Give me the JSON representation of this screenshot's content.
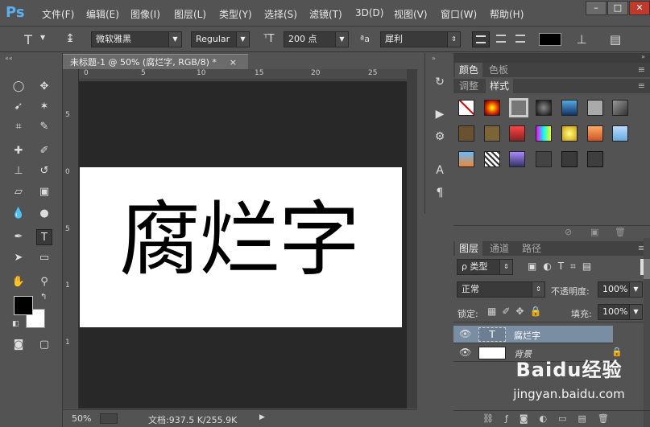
{
  "app": {
    "logo": "Ps"
  },
  "menu": [
    "文件(F)",
    "编辑(E)",
    "图像(I)",
    "图层(L)",
    "类型(Y)",
    "选择(S)",
    "滤镜(T)",
    "3D(D)",
    "视图(V)",
    "窗口(W)",
    "帮助(H)"
  ],
  "window_controls": {
    "minimize": "–",
    "maximize": "□",
    "close": "✕"
  },
  "options": {
    "tool_glyph": "T",
    "font_family": "微软雅黑",
    "font_style": "Regular",
    "font_size": "200 点",
    "aa_label": "ªa",
    "antialias": "犀利",
    "text_color": "#000000"
  },
  "document": {
    "tab_title": "未标题-1 @ 50% (腐烂字, RGB/8) *",
    "close": "×",
    "text": "腐烂字",
    "ruler_h": [
      "0",
      "5",
      "10",
      "15",
      "20",
      "25"
    ],
    "ruler_v": [
      "5",
      "0",
      "5",
      "1",
      "1"
    ]
  },
  "status": {
    "zoom": "50%",
    "doc_info": "文档:937.5 K/255.9K"
  },
  "colors": {
    "foreground": "#000000",
    "background": "#ffffff",
    "accent_selected_layer": "#7a8ea3"
  },
  "panels": {
    "color_tabs": [
      "颜色",
      "色板"
    ],
    "adjust_tabs": [
      "调整",
      "样式"
    ],
    "layer_tabs": [
      "图层",
      "通道",
      "路径"
    ],
    "filter_kind": "ρ 类型",
    "blend_mode": "正常",
    "opacity_label": "不透明度:",
    "opacity": "100%",
    "lock_label": "锁定:",
    "fill_label": "填充:",
    "fill": "100%",
    "layers": [
      {
        "name": "腐烂字",
        "type": "text",
        "thumb": "T"
      },
      {
        "name": "背景",
        "type": "background"
      }
    ]
  },
  "watermark": {
    "brand": "Baidu经验",
    "url": "jingyan.baidu.com"
  }
}
